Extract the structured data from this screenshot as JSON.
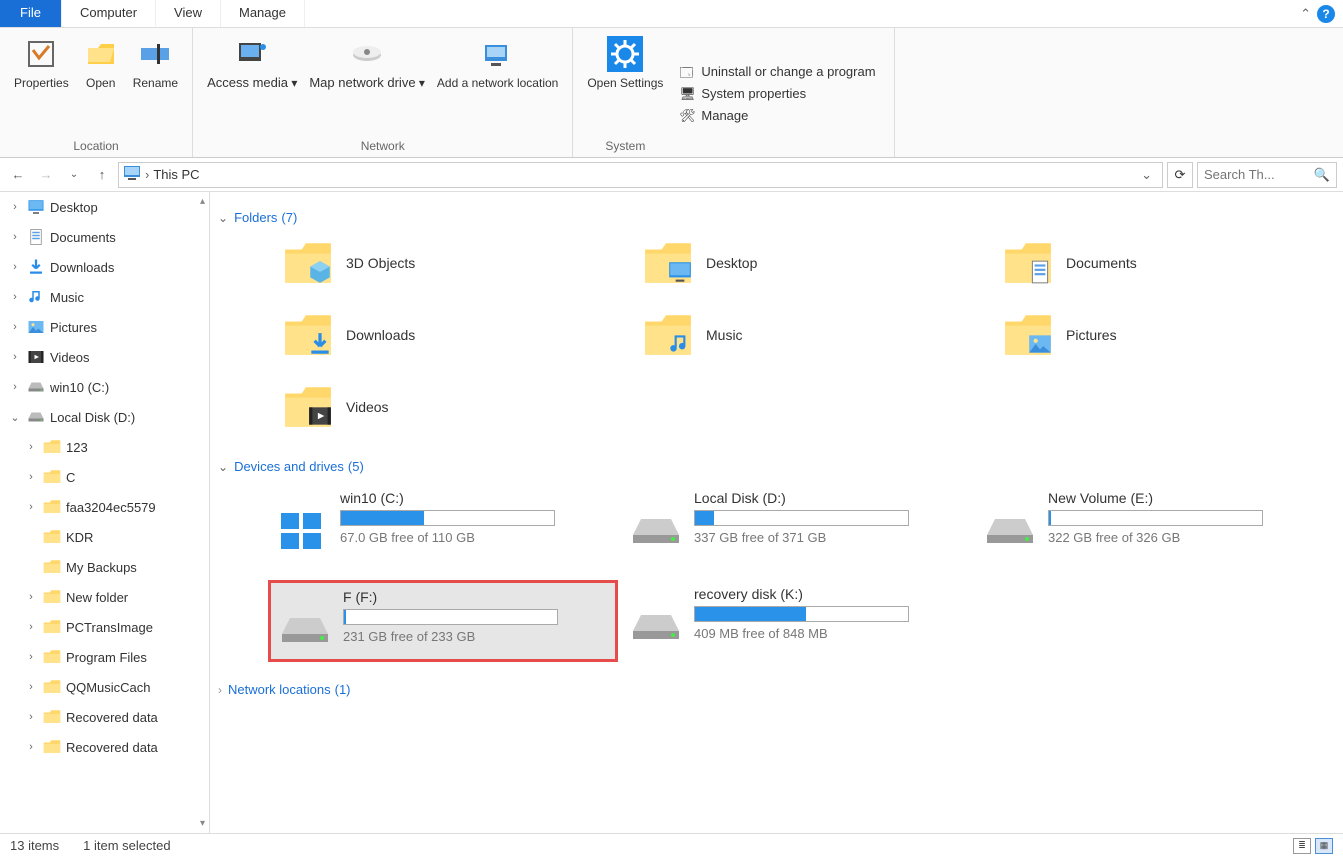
{
  "menubar": {
    "file": "File",
    "tabs": [
      "Computer",
      "View",
      "Manage"
    ],
    "active": 0
  },
  "ribbon": {
    "location": {
      "label": "Location",
      "properties": "Properties",
      "open": "Open",
      "rename": "Rename"
    },
    "network": {
      "label": "Network",
      "access_media": "Access media",
      "map_drive": "Map network drive",
      "add_location": "Add a network location"
    },
    "system": {
      "label": "System",
      "open_settings": "Open Settings",
      "uninstall": "Uninstall or change a program",
      "sysprops": "System properties",
      "manage": "Manage"
    }
  },
  "address": {
    "location": "This PC",
    "search_placeholder": "Search Th..."
  },
  "sidebar": [
    {
      "label": "Desktop",
      "icon": "desktop",
      "level": 0,
      "exp": "›"
    },
    {
      "label": "Documents",
      "icon": "documents",
      "level": 0,
      "exp": "›"
    },
    {
      "label": "Downloads",
      "icon": "downloads",
      "level": 0,
      "exp": "›"
    },
    {
      "label": "Music",
      "icon": "music",
      "level": 0,
      "exp": "›"
    },
    {
      "label": "Pictures",
      "icon": "pictures",
      "level": 0,
      "exp": "›"
    },
    {
      "label": "Videos",
      "icon": "videos",
      "level": 0,
      "exp": "›"
    },
    {
      "label": "win10 (C:)",
      "icon": "drive",
      "level": 0,
      "exp": "›"
    },
    {
      "label": "Local Disk (D:)",
      "icon": "drive",
      "level": 0,
      "exp": "⌄"
    },
    {
      "label": "123",
      "icon": "folder",
      "level": 1,
      "exp": "›"
    },
    {
      "label": "C",
      "icon": "folder",
      "level": 1,
      "exp": "›"
    },
    {
      "label": "faa3204ec5579",
      "icon": "folder",
      "level": 1,
      "exp": "›"
    },
    {
      "label": "KDR",
      "icon": "folder",
      "level": 1,
      "exp": ""
    },
    {
      "label": "My Backups",
      "icon": "folder",
      "level": 1,
      "exp": ""
    },
    {
      "label": "New folder",
      "icon": "folder",
      "level": 1,
      "exp": "›"
    },
    {
      "label": "PCTransImage",
      "icon": "folder",
      "level": 1,
      "exp": "›"
    },
    {
      "label": "Program Files",
      "icon": "folder",
      "level": 1,
      "exp": "›"
    },
    {
      "label": "QQMusicCach",
      "icon": "folder",
      "level": 1,
      "exp": "›"
    },
    {
      "label": "Recovered data",
      "icon": "folder",
      "level": 1,
      "exp": "›"
    },
    {
      "label": "Recovered data",
      "icon": "folder",
      "level": 1,
      "exp": "›"
    }
  ],
  "groups": {
    "folders": {
      "title": "Folders",
      "count": "(7)"
    },
    "drives": {
      "title": "Devices and drives",
      "count": "(5)"
    },
    "network": {
      "title": "Network locations",
      "count": "(1)"
    }
  },
  "folders": [
    {
      "name": "3D Objects",
      "icon": "3d"
    },
    {
      "name": "Desktop",
      "icon": "desktop"
    },
    {
      "name": "Documents",
      "icon": "documents"
    },
    {
      "name": "Downloads",
      "icon": "downloads"
    },
    {
      "name": "Music",
      "icon": "music"
    },
    {
      "name": "Pictures",
      "icon": "pictures"
    },
    {
      "name": "Videos",
      "icon": "videos"
    }
  ],
  "drives": [
    {
      "name": "win10 (C:)",
      "free": "67.0 GB free of 110 GB",
      "pct": 39,
      "icon": "windrive",
      "selected": false
    },
    {
      "name": "Local Disk (D:)",
      "free": "337 GB free of 371 GB",
      "pct": 9,
      "icon": "drive",
      "selected": false
    },
    {
      "name": "New Volume (E:)",
      "free": "322 GB free of 326 GB",
      "pct": 1,
      "icon": "drive",
      "selected": false
    },
    {
      "name": "F (F:)",
      "free": "231 GB free of 233 GB",
      "pct": 1,
      "icon": "drive",
      "selected": true
    },
    {
      "name": "recovery disk (K:)",
      "free": "409 MB free of 848 MB",
      "pct": 52,
      "icon": "drive",
      "selected": false
    }
  ],
  "status": {
    "items": "13 items",
    "selected": "1 item selected"
  }
}
